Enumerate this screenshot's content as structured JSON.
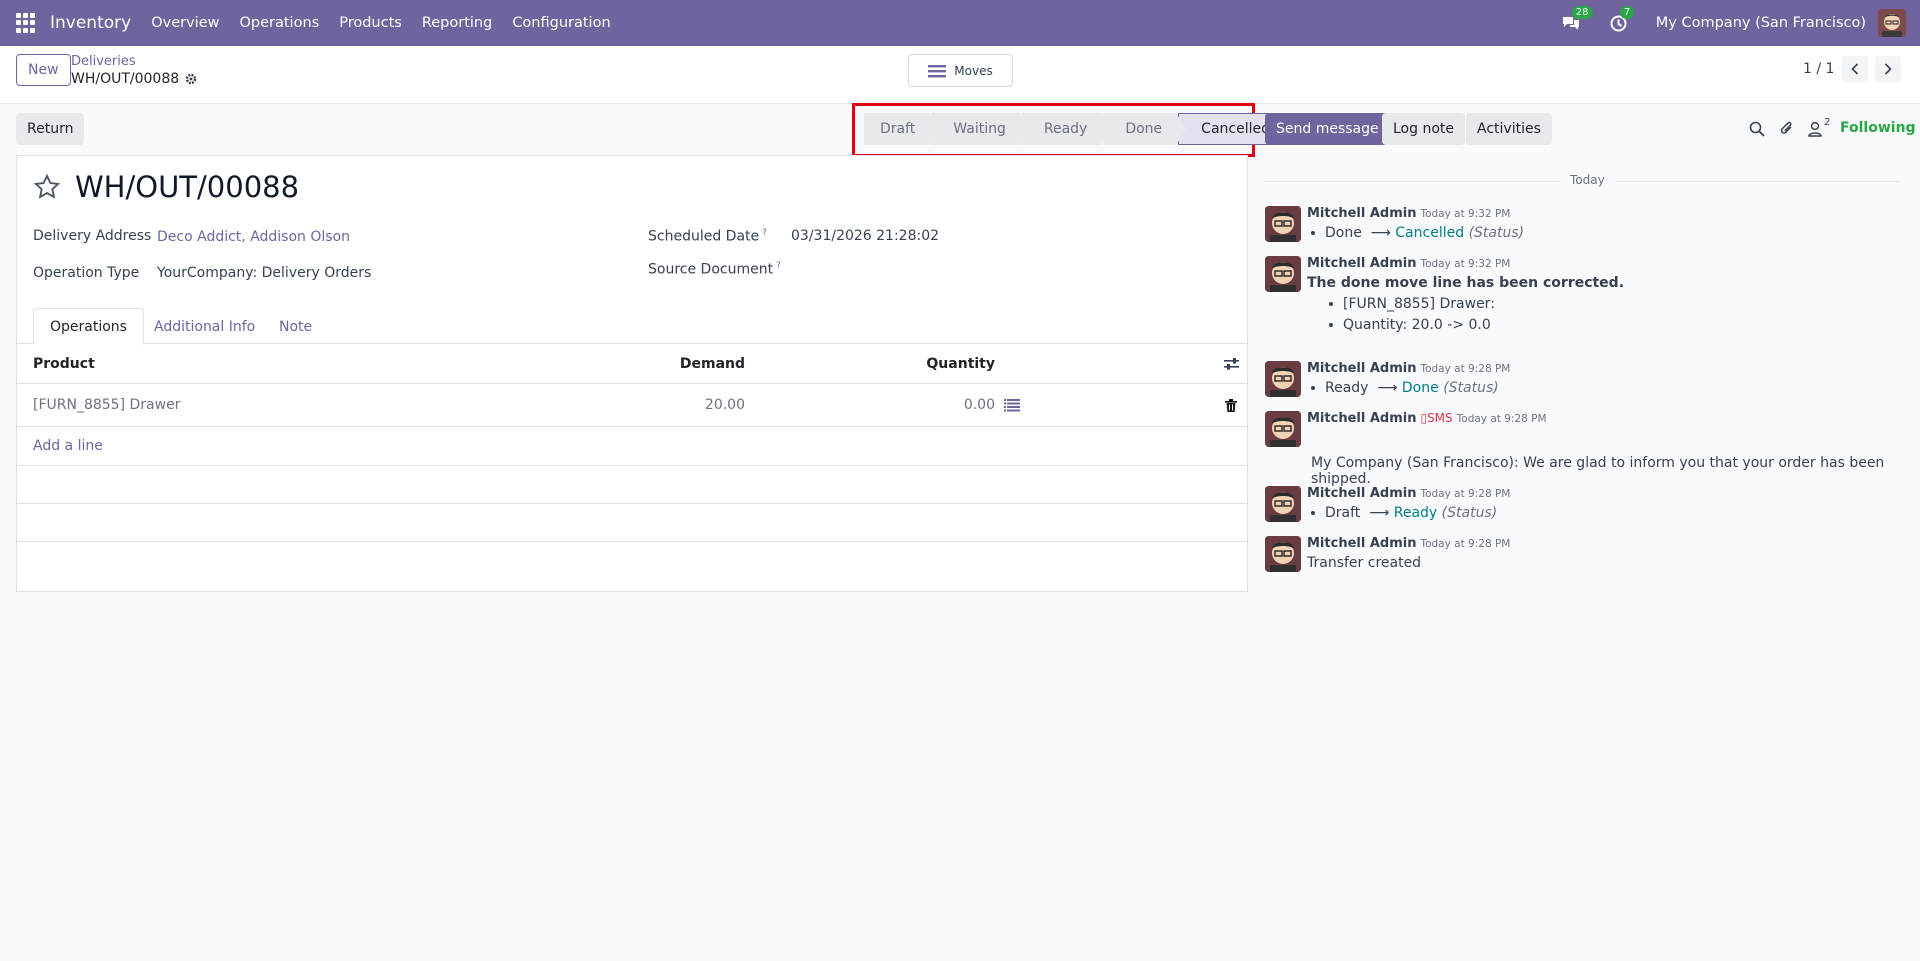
{
  "navbar": {
    "brand": "Inventory",
    "menu": [
      "Overview",
      "Operations",
      "Products",
      "Reporting",
      "Configuration"
    ],
    "messages_count": "28",
    "activities_count": "7",
    "company": "My Company (San Francisco)"
  },
  "control": {
    "new_label": "New",
    "breadcrumb_parent": "Deliveries",
    "breadcrumb_current": "WH/OUT/00088",
    "moves_label": "Moves",
    "pager": "1 / 1"
  },
  "actions": {
    "return_label": "Return"
  },
  "statusbar": {
    "stages": [
      "Draft",
      "Waiting",
      "Ready",
      "Done",
      "Cancelled"
    ],
    "active": "Cancelled"
  },
  "record": {
    "title": "WH/OUT/00088",
    "delivery_address_label": "Delivery Address",
    "delivery_address": "Deco Addict, Addison Olson",
    "operation_type_label": "Operation Type",
    "operation_type": "YourCompany: Delivery Orders",
    "scheduled_date_label": "Scheduled Date",
    "scheduled_date": "03/31/2026 21:28:02",
    "source_document_label": "Source Document",
    "help_mark": "?"
  },
  "tabs": [
    "Operations",
    "Additional Info",
    "Note"
  ],
  "table": {
    "headers": {
      "product": "Product",
      "demand": "Demand",
      "quantity": "Quantity"
    },
    "rows": [
      {
        "product": "[FURN_8855] Drawer",
        "demand": "20.00",
        "quantity": "0.00"
      }
    ],
    "add_line": "Add a line"
  },
  "chatter": {
    "send_message": "Send message",
    "log_note": "Log note",
    "activities": "Activities",
    "followers_count": "2",
    "following": "Following",
    "day_label": "Today",
    "messages": [
      {
        "author": "Mitchell Admin",
        "date": "Today at 9:32 PM",
        "from": "Done",
        "to": "Cancelled",
        "field": "(Status)"
      },
      {
        "author": "Mitchell Admin",
        "date": "Today at 9:32 PM",
        "headline": "The done move line has been corrected.",
        "items": [
          "[FURN_8855] Drawer:",
          "Quantity: 20.0 -> 0.0"
        ]
      },
      {
        "author": "Mitchell Admin",
        "date": "Today at 9:28 PM",
        "from": "Ready",
        "to": "Done",
        "field": "(Status)"
      },
      {
        "author": "Mitchell Admin",
        "sms": "SMS",
        "date": "Today at 9:28 PM",
        "text": "My Company (San Francisco): We are glad to inform you that your order has been shipped."
      },
      {
        "author": "Mitchell Admin",
        "date": "Today at 9:28 PM",
        "from": "Draft",
        "to": "Ready",
        "field": "(Status)"
      },
      {
        "author": "Mitchell Admin",
        "date": "Today at 9:28 PM",
        "text": "Transfer created"
      }
    ]
  },
  "colors": {
    "brand": "#71639e",
    "highlight": "#e4000f",
    "teal": "#017e84",
    "success": "#28a745"
  }
}
